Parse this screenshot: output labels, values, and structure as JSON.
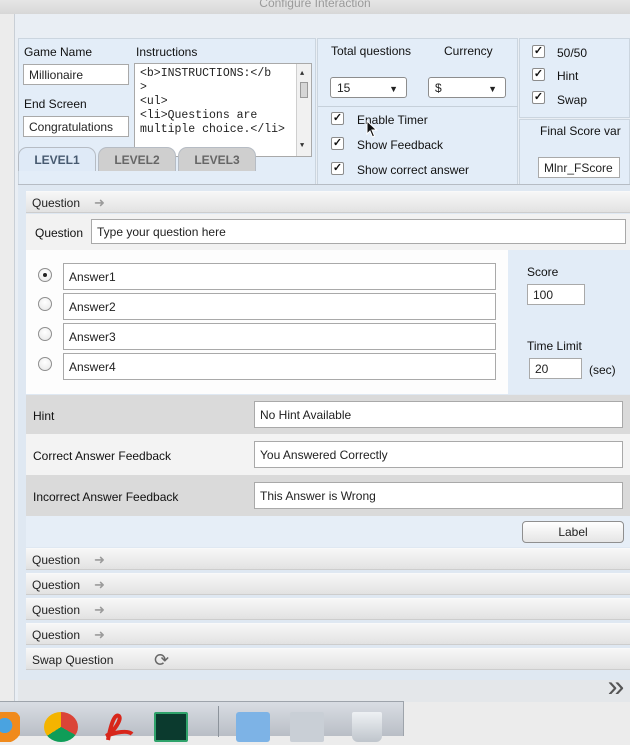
{
  "window": {
    "title": "Configure Interaction"
  },
  "settings": {
    "game_name_label": "Game Name",
    "game_name_value": "Millionaire",
    "end_screen_label": "End Screen",
    "end_screen_value": "Congratulations",
    "instructions_label": "Instructions",
    "instructions_lines": [
      "<b>INSTRUCTIONS:</b",
      ">",
      "<ul>",
      "<li>Questions are",
      "multiple choice.</li>"
    ]
  },
  "totals": {
    "total_questions_label": "Total questions",
    "total_questions_value": "15",
    "currency_label": "Currency",
    "currency_value": "$",
    "enable_timer_label": "Enable Timer",
    "show_feedback_label": "Show Feedback",
    "show_correct_label": "Show correct answer"
  },
  "lifelines": {
    "fifty_label": "50/50",
    "hint_label": "Hint",
    "swap_label": "Swap",
    "check_mark": "✓",
    "final_score_label": "Final Score var",
    "final_score_value": "Mlnr_FScore"
  },
  "tabs": [
    "LEVEL1",
    "LEVEL2",
    "LEVEL3"
  ],
  "question_header": "Question",
  "question": {
    "label": "Question",
    "value": "Type your question here"
  },
  "answers": [
    {
      "value": "Answer1",
      "selected": true
    },
    {
      "value": "Answer2",
      "selected": false
    },
    {
      "value": "Answer3",
      "selected": false
    },
    {
      "value": "Answer4",
      "selected": false
    }
  ],
  "score": {
    "label": "Score",
    "value": "100"
  },
  "time_limit": {
    "label": "Time Limit",
    "value": "20",
    "unit": "(sec)"
  },
  "hint": {
    "label": "Hint",
    "value": "No Hint Available"
  },
  "correct_feedback": {
    "label": "Correct Answer Feedback",
    "value": "You Answered Correctly"
  },
  "incorrect_feedback": {
    "label": "Incorrect Answer Feedback",
    "value": "This Answer is Wrong"
  },
  "label_button": "Label",
  "collapsed_questions": [
    "Question",
    "Question",
    "Question",
    "Question"
  ],
  "swap_question": "Swap Question",
  "next_button": "»",
  "icons": {
    "arrow_right": "➜",
    "refresh": "⟳",
    "caret_down": "▼",
    "scroll_up": "▲",
    "scroll_down": "▼"
  }
}
